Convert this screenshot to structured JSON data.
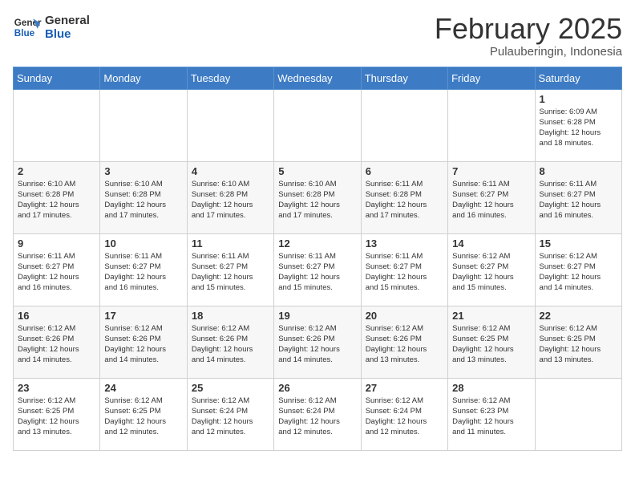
{
  "logo": {
    "line1": "General",
    "line2": "Blue"
  },
  "title": {
    "month_year": "February 2025",
    "location": "Pulauberingin, Indonesia"
  },
  "weekdays": [
    "Sunday",
    "Monday",
    "Tuesday",
    "Wednesday",
    "Thursday",
    "Friday",
    "Saturday"
  ],
  "weeks": [
    [
      {
        "day": "",
        "info": ""
      },
      {
        "day": "",
        "info": ""
      },
      {
        "day": "",
        "info": ""
      },
      {
        "day": "",
        "info": ""
      },
      {
        "day": "",
        "info": ""
      },
      {
        "day": "",
        "info": ""
      },
      {
        "day": "1",
        "info": "Sunrise: 6:09 AM\nSunset: 6:28 PM\nDaylight: 12 hours\nand 18 minutes."
      }
    ],
    [
      {
        "day": "2",
        "info": "Sunrise: 6:10 AM\nSunset: 6:28 PM\nDaylight: 12 hours\nand 17 minutes."
      },
      {
        "day": "3",
        "info": "Sunrise: 6:10 AM\nSunset: 6:28 PM\nDaylight: 12 hours\nand 17 minutes."
      },
      {
        "day": "4",
        "info": "Sunrise: 6:10 AM\nSunset: 6:28 PM\nDaylight: 12 hours\nand 17 minutes."
      },
      {
        "day": "5",
        "info": "Sunrise: 6:10 AM\nSunset: 6:28 PM\nDaylight: 12 hours\nand 17 minutes."
      },
      {
        "day": "6",
        "info": "Sunrise: 6:11 AM\nSunset: 6:28 PM\nDaylight: 12 hours\nand 17 minutes."
      },
      {
        "day": "7",
        "info": "Sunrise: 6:11 AM\nSunset: 6:27 PM\nDaylight: 12 hours\nand 16 minutes."
      },
      {
        "day": "8",
        "info": "Sunrise: 6:11 AM\nSunset: 6:27 PM\nDaylight: 12 hours\nand 16 minutes."
      }
    ],
    [
      {
        "day": "9",
        "info": "Sunrise: 6:11 AM\nSunset: 6:27 PM\nDaylight: 12 hours\nand 16 minutes."
      },
      {
        "day": "10",
        "info": "Sunrise: 6:11 AM\nSunset: 6:27 PM\nDaylight: 12 hours\nand 16 minutes."
      },
      {
        "day": "11",
        "info": "Sunrise: 6:11 AM\nSunset: 6:27 PM\nDaylight: 12 hours\nand 15 minutes."
      },
      {
        "day": "12",
        "info": "Sunrise: 6:11 AM\nSunset: 6:27 PM\nDaylight: 12 hours\nand 15 minutes."
      },
      {
        "day": "13",
        "info": "Sunrise: 6:11 AM\nSunset: 6:27 PM\nDaylight: 12 hours\nand 15 minutes."
      },
      {
        "day": "14",
        "info": "Sunrise: 6:12 AM\nSunset: 6:27 PM\nDaylight: 12 hours\nand 15 minutes."
      },
      {
        "day": "15",
        "info": "Sunrise: 6:12 AM\nSunset: 6:27 PM\nDaylight: 12 hours\nand 14 minutes."
      }
    ],
    [
      {
        "day": "16",
        "info": "Sunrise: 6:12 AM\nSunset: 6:26 PM\nDaylight: 12 hours\nand 14 minutes."
      },
      {
        "day": "17",
        "info": "Sunrise: 6:12 AM\nSunset: 6:26 PM\nDaylight: 12 hours\nand 14 minutes."
      },
      {
        "day": "18",
        "info": "Sunrise: 6:12 AM\nSunset: 6:26 PM\nDaylight: 12 hours\nand 14 minutes."
      },
      {
        "day": "19",
        "info": "Sunrise: 6:12 AM\nSunset: 6:26 PM\nDaylight: 12 hours\nand 14 minutes."
      },
      {
        "day": "20",
        "info": "Sunrise: 6:12 AM\nSunset: 6:26 PM\nDaylight: 12 hours\nand 13 minutes."
      },
      {
        "day": "21",
        "info": "Sunrise: 6:12 AM\nSunset: 6:25 PM\nDaylight: 12 hours\nand 13 minutes."
      },
      {
        "day": "22",
        "info": "Sunrise: 6:12 AM\nSunset: 6:25 PM\nDaylight: 12 hours\nand 13 minutes."
      }
    ],
    [
      {
        "day": "23",
        "info": "Sunrise: 6:12 AM\nSunset: 6:25 PM\nDaylight: 12 hours\nand 13 minutes."
      },
      {
        "day": "24",
        "info": "Sunrise: 6:12 AM\nSunset: 6:25 PM\nDaylight: 12 hours\nand 12 minutes."
      },
      {
        "day": "25",
        "info": "Sunrise: 6:12 AM\nSunset: 6:24 PM\nDaylight: 12 hours\nand 12 minutes."
      },
      {
        "day": "26",
        "info": "Sunrise: 6:12 AM\nSunset: 6:24 PM\nDaylight: 12 hours\nand 12 minutes."
      },
      {
        "day": "27",
        "info": "Sunrise: 6:12 AM\nSunset: 6:24 PM\nDaylight: 12 hours\nand 12 minutes."
      },
      {
        "day": "28",
        "info": "Sunrise: 6:12 AM\nSunset: 6:23 PM\nDaylight: 12 hours\nand 11 minutes."
      },
      {
        "day": "",
        "info": ""
      }
    ]
  ]
}
